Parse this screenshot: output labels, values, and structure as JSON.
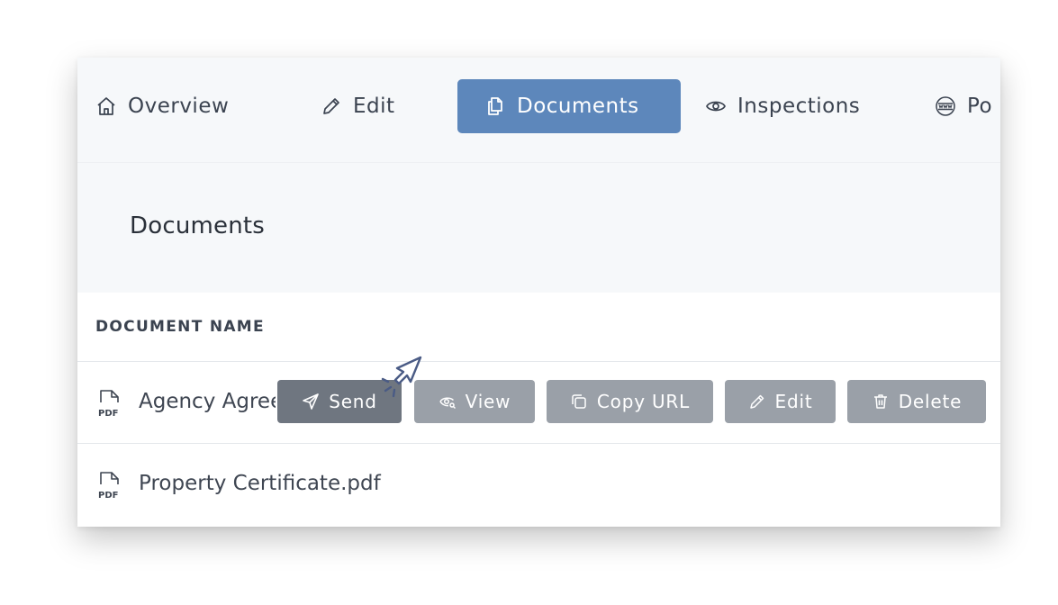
{
  "tabs": [
    {
      "label": "Overview",
      "icon": "home-icon"
    },
    {
      "label": "Edit",
      "icon": "pencil-icon"
    },
    {
      "label": "Documents",
      "icon": "copy-icon",
      "active": true
    },
    {
      "label": "Inspections",
      "icon": "eye-icon"
    },
    {
      "label": "Po",
      "icon": "www-globe-icon"
    }
  ],
  "section": {
    "title": "Documents"
  },
  "table": {
    "column_header": "DOCUMENT NAME",
    "rows": [
      {
        "name": "Agency Agreement.pdf",
        "icon": "pdf-file-icon"
      },
      {
        "name": "Property Certificate.pdf",
        "icon": "pdf-file-icon"
      }
    ]
  },
  "actions": {
    "send": "Send",
    "view": "View",
    "copy_url": "Copy URL",
    "edit": "Edit",
    "delete": "Delete"
  },
  "colors": {
    "active_tab": "#5d87bb",
    "button": "#9aa0a8",
    "button_hover": "#6f7680",
    "panel_background": "#f6f8fa"
  }
}
